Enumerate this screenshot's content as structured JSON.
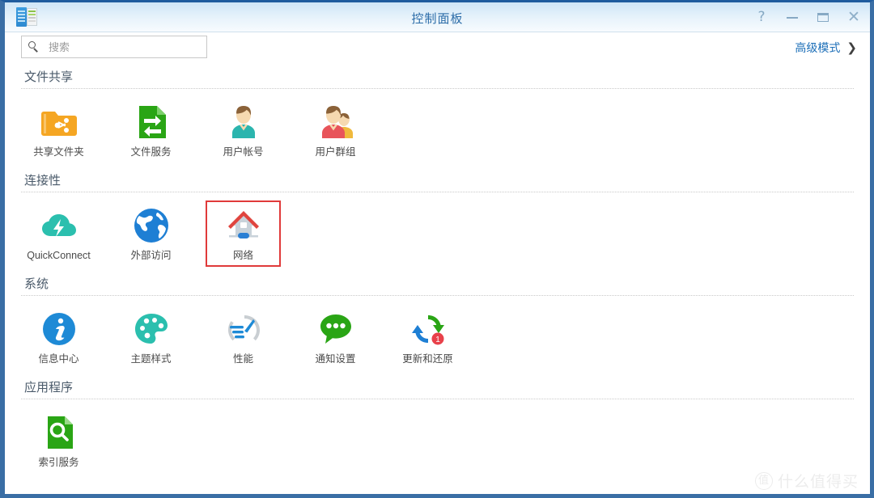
{
  "window": {
    "title": "控制面板",
    "app_icon": "control-panel-icon",
    "controls": [
      {
        "name": "help-button",
        "label": "?"
      },
      {
        "name": "minimize-button",
        "label": ""
      },
      {
        "name": "maximize-button",
        "label": ""
      },
      {
        "name": "close-button",
        "label": "✕"
      }
    ]
  },
  "toolbar": {
    "search_placeholder": "搜索",
    "search_value": "",
    "search_icon": "search-icon",
    "advanced_mode_label": "高级模式",
    "advanced_mode_chevron": "❯"
  },
  "sections": [
    {
      "title": "文件共享",
      "items": [
        {
          "label": "共享文件夹",
          "icon": "shared-folder-icon",
          "selected": false
        },
        {
          "label": "文件服务",
          "icon": "file-services-icon",
          "selected": false
        },
        {
          "label": "用户帐号",
          "icon": "user-account-icon",
          "selected": false
        },
        {
          "label": "用户群组",
          "icon": "user-group-icon",
          "selected": false
        }
      ]
    },
    {
      "title": "连接性",
      "items": [
        {
          "label": "QuickConnect",
          "icon": "quickconnect-cloud-icon",
          "selected": false
        },
        {
          "label": "外部访问",
          "icon": "external-access-globe-icon",
          "selected": false
        },
        {
          "label": "网络",
          "icon": "network-house-icon",
          "selected": true
        }
      ]
    },
    {
      "title": "系统",
      "items": [
        {
          "label": "信息中心",
          "icon": "info-center-icon",
          "selected": false
        },
        {
          "label": "主题样式",
          "icon": "theme-palette-icon",
          "selected": false
        },
        {
          "label": "性能",
          "icon": "performance-gauge-icon",
          "selected": false
        },
        {
          "label": "通知设置",
          "icon": "notification-bubble-icon",
          "selected": false
        },
        {
          "label": "更新和还原",
          "icon": "update-restore-icon",
          "selected": false,
          "badge": "1"
        }
      ]
    },
    {
      "title": "应用程序",
      "items": [
        {
          "label": "索引服务",
          "icon": "indexing-service-icon",
          "selected": false
        }
      ]
    }
  ],
  "watermark": {
    "badge": "值",
    "text": "什么值得买"
  },
  "colors": {
    "accent": "#1d6fb8",
    "title": "#2b6ca8",
    "selection": "#e03a3a",
    "frame": "#3a6ea5"
  }
}
